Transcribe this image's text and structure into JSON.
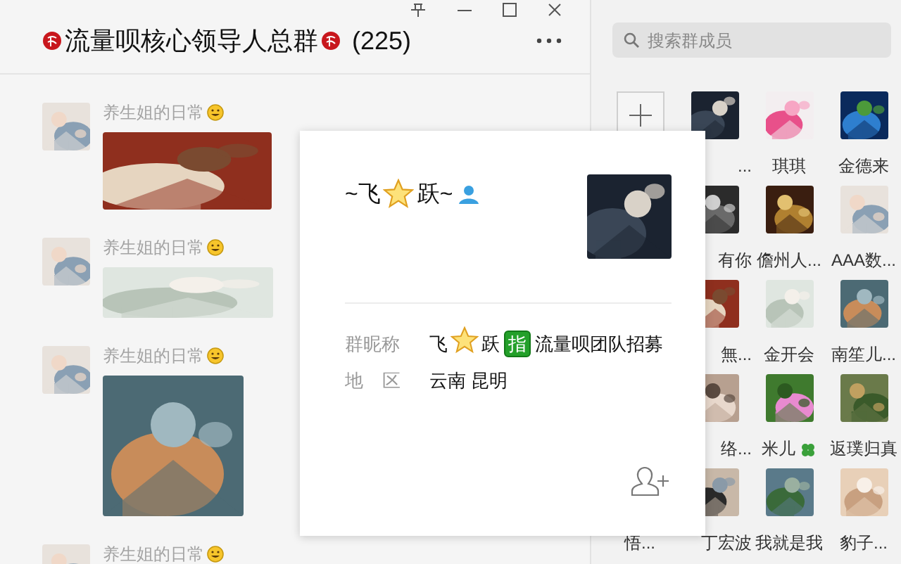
{
  "chat": {
    "title": "流量呗核心领导人总群",
    "count": "(225)",
    "messages": [
      {
        "sender": "养生姐的日常",
        "kind": "picture"
      },
      {
        "sender": "养生姐的日常",
        "kind": "picture"
      },
      {
        "sender": "养生姐的日常",
        "kind": "picture"
      },
      {
        "sender": "养生姐的日常"
      }
    ]
  },
  "members": {
    "search": {
      "placeholder": "搜索群成员"
    },
    "rows": [
      [
        {
          "kind": "add"
        },
        {
          "kind": "member",
          "name": "..."
        },
        {
          "kind": "member",
          "name": "琪琪"
        },
        {
          "kind": "member",
          "name": "金德来"
        }
      ],
      [
        {
          "kind": "member",
          "name": "有你"
        },
        {
          "kind": "member",
          "name": "儋州人..."
        },
        {
          "kind": "member",
          "name": "AAA数..."
        }
      ],
      [
        {
          "kind": "member",
          "name": "無..."
        },
        {
          "kind": "member",
          "name": "金开会"
        },
        {
          "kind": "member",
          "name": "南笙儿..."
        }
      ],
      [
        {
          "kind": "member",
          "name": "络..."
        },
        {
          "kind": "member",
          "name": "米儿",
          "clover": true
        },
        {
          "kind": "member",
          "name": "返璞归真"
        }
      ],
      [
        {
          "kind": "member",
          "name": "悟..."
        },
        {
          "kind": "member",
          "name": "丁宏波"
        },
        {
          "kind": "member",
          "name": "我就是我"
        },
        {
          "kind": "member",
          "name": "豹子..."
        }
      ]
    ]
  },
  "profile": {
    "name": [
      {
        "kind": "text",
        "text": "~飞"
      },
      {
        "kind": "star"
      },
      {
        "kind": "text",
        "text": "跃~"
      }
    ],
    "fields": [
      {
        "label": "群昵称",
        "parts": [
          {
            "kind": "text",
            "text": "飞"
          },
          {
            "kind": "star"
          },
          {
            "kind": "text",
            "text": "跃"
          },
          {
            "kind": "badge",
            "text": "指"
          },
          {
            "kind": "text",
            "text": "流量呗团队招募"
          }
        ]
      },
      {
        "label": "地 区",
        "parts": [
          {
            "kind": "text",
            "text": "云南 昆明"
          }
        ]
      }
    ]
  }
}
